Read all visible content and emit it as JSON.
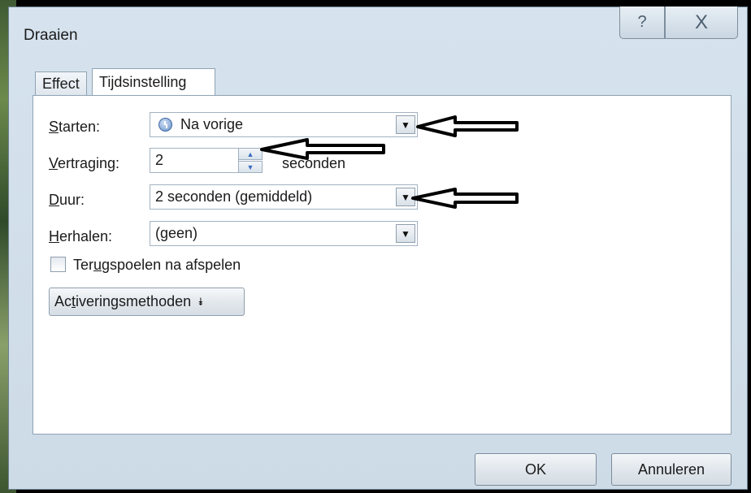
{
  "dialog": {
    "title": "Draaien",
    "help_glyph": "?",
    "close_glyph": "X"
  },
  "tabs": [
    {
      "label": "Effect"
    },
    {
      "label": "Tijdsinstelling"
    }
  ],
  "fields": {
    "start": {
      "label_mnemonic": "S",
      "label_rest": "tarten:",
      "value": "Na vorige",
      "icon": "clock-icon"
    },
    "delay": {
      "label_mnemonic": "V",
      "label_rest": "ertraging:",
      "value": "2",
      "unit": "seconden"
    },
    "duration": {
      "label_mnemonic": "D",
      "label_rest": "uur:",
      "value": "2 seconden (gemiddeld)"
    },
    "repeat": {
      "label_mnemonic": "H",
      "label_rest": "erhalen:",
      "value": "(geen)"
    }
  },
  "rewind": {
    "label_a": "Ter",
    "label_mnemonic": "u",
    "label_b": "gspoelen na afspelen",
    "checked": false
  },
  "triggers": {
    "label_a": "Ac",
    "label_mnemonic": "t",
    "label_b": "iveringsmethoden",
    "icon": "double-chevron-down-icon"
  },
  "buttons": {
    "ok": "OK",
    "cancel": "Annuleren"
  },
  "colors": {
    "window_frame": "#d6e3ee",
    "panel": "#ffffff",
    "annotation_arrows": "#000000"
  }
}
